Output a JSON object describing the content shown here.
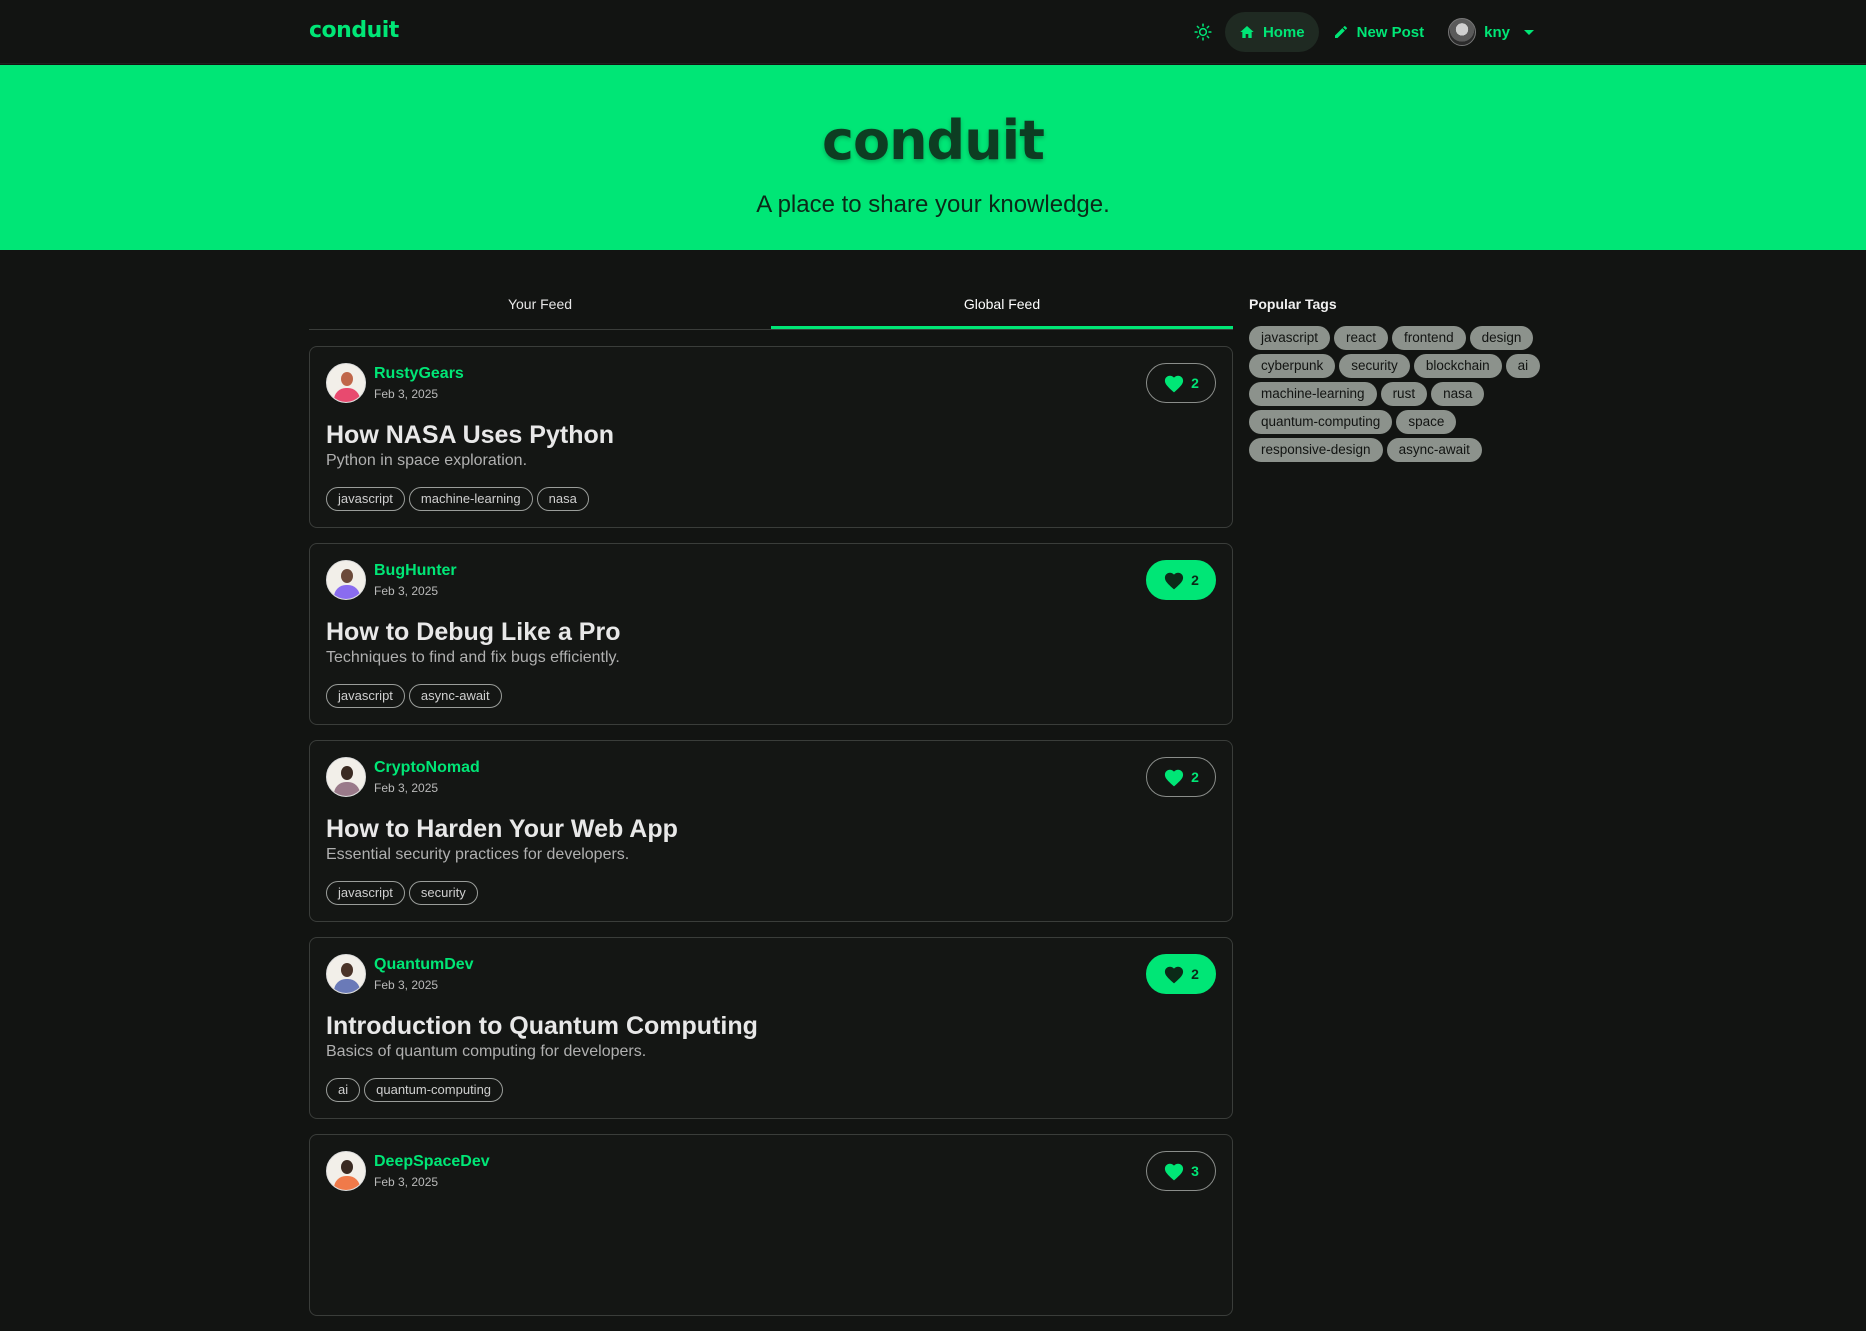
{
  "navbar": {
    "brand": "conduit",
    "theme_icon": "sun-icon",
    "home_label": "Home",
    "new_post_label": "New Post",
    "username": "kny"
  },
  "banner": {
    "title": "conduit",
    "subtitle": "A place to share your knowledge."
  },
  "feed": {
    "tabs": [
      {
        "label": "Your Feed",
        "active": false
      },
      {
        "label": "Global Feed",
        "active": true
      }
    ],
    "articles": [
      {
        "author": "RustyGears",
        "date": "Feb 3, 2025",
        "favorites": "2",
        "favorited": false,
        "title": "How NASA Uses Python",
        "description": "Python in space exploration.",
        "tags": [
          "javascript",
          "machine-learning",
          "nasa"
        ]
      },
      {
        "author": "BugHunter",
        "date": "Feb 3, 2025",
        "favorites": "2",
        "favorited": true,
        "title": "How to Debug Like a Pro",
        "description": "Techniques to find and fix bugs efficiently.",
        "tags": [
          "javascript",
          "async-await"
        ]
      },
      {
        "author": "CryptoNomad",
        "date": "Feb 3, 2025",
        "favorites": "2",
        "favorited": false,
        "title": "How to Harden Your Web App",
        "description": "Essential security practices for developers.",
        "tags": [
          "javascript",
          "security"
        ]
      },
      {
        "author": "QuantumDev",
        "date": "Feb 3, 2025",
        "favorites": "2",
        "favorited": true,
        "title": "Introduction to Quantum Computing",
        "description": "Basics of quantum computing for developers.",
        "tags": [
          "ai",
          "quantum-computing"
        ]
      },
      {
        "author": "DeepSpaceDev",
        "date": "Feb 3, 2025",
        "favorites": "3",
        "favorited": false,
        "title": "",
        "description": "",
        "tags": []
      }
    ]
  },
  "sidebar": {
    "title": "Popular Tags",
    "tags": [
      "javascript",
      "react",
      "frontend",
      "design",
      "cyberpunk",
      "security",
      "blockchain",
      "ai",
      "machine-learning",
      "rust",
      "nasa",
      "quantum-computing",
      "space",
      "responsive-design",
      "async-await"
    ]
  },
  "colors": {
    "accent": "#00e676",
    "background": "#121412",
    "banner_text": "#0d3d22"
  }
}
